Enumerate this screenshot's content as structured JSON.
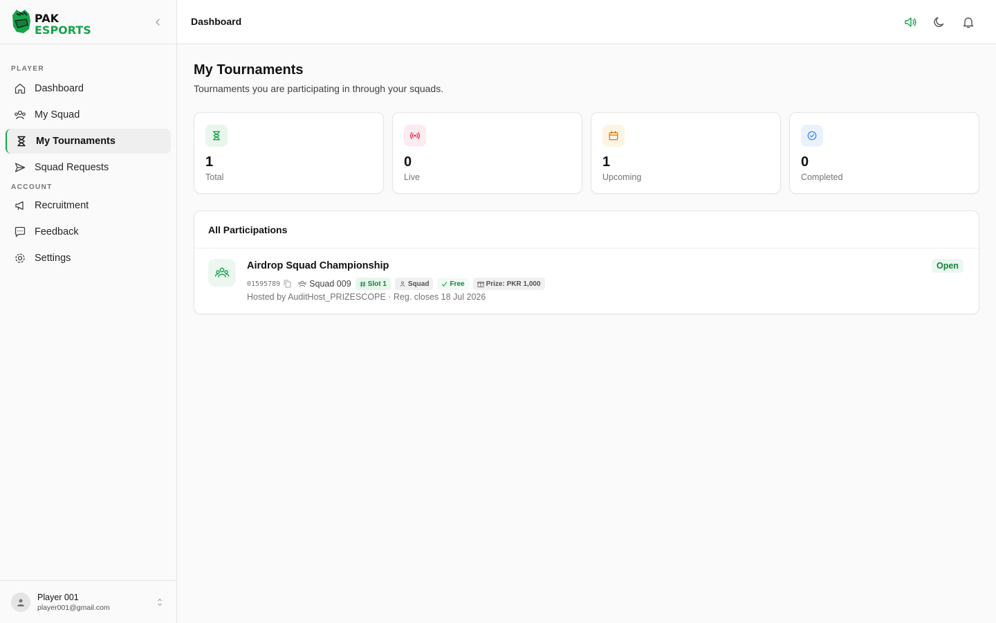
{
  "brand": {
    "name_line1": "PAK",
    "name_line2": "ESPORTS",
    "accent": "#16a34a"
  },
  "sidebar": {
    "sections": [
      {
        "label": "PLAYER"
      },
      {
        "label": "ACCOUNT"
      }
    ],
    "items": [
      {
        "label": "Dashboard",
        "icon": "home-icon"
      },
      {
        "label": "My Squad",
        "icon": "users-icon"
      },
      {
        "label": "My Tournaments",
        "icon": "hourglass-icon",
        "active": true
      },
      {
        "label": "Squad Requests",
        "icon": "send-icon"
      },
      {
        "label": "Recruitment",
        "icon": "megaphone-icon"
      },
      {
        "label": "Feedback",
        "icon": "message-icon"
      },
      {
        "label": "Settings",
        "icon": "gear-icon"
      }
    ],
    "user": {
      "name": "Player 001",
      "email": "player001@gmail.com"
    }
  },
  "topbar": {
    "breadcrumb": "Dashboard"
  },
  "page": {
    "title": "My Tournaments",
    "subtitle": "Tournaments you are participating in through your squads."
  },
  "stats": [
    {
      "value": "1",
      "label": "Total",
      "icon": "hourglass-icon",
      "color": "#16a34a",
      "bg": "#e8f6ec"
    },
    {
      "value": "0",
      "label": "Live",
      "icon": "broadcast-icon",
      "color": "#e11d48",
      "bg": "#fdecef"
    },
    {
      "value": "1",
      "label": "Upcoming",
      "icon": "calendar-icon",
      "color": "#d97706",
      "bg": "#fdf5e3"
    },
    {
      "value": "0",
      "label": "Completed",
      "icon": "check-circle-icon",
      "color": "#3b82f6",
      "bg": "#eaf2fd"
    }
  ],
  "participations": {
    "title": "All Participations",
    "items": [
      {
        "name": "Airdrop Squad Championship",
        "id": "01595789",
        "squad": "Squad 009",
        "slot": "Slot 1",
        "mode": "Squad",
        "entry": "Free",
        "prize": "Prize: PKR 1,000",
        "host_line": "Hosted by AuditHost_PRIZESCOPE · Reg. closes 18 Jul 2026",
        "status": "Open"
      }
    ]
  }
}
